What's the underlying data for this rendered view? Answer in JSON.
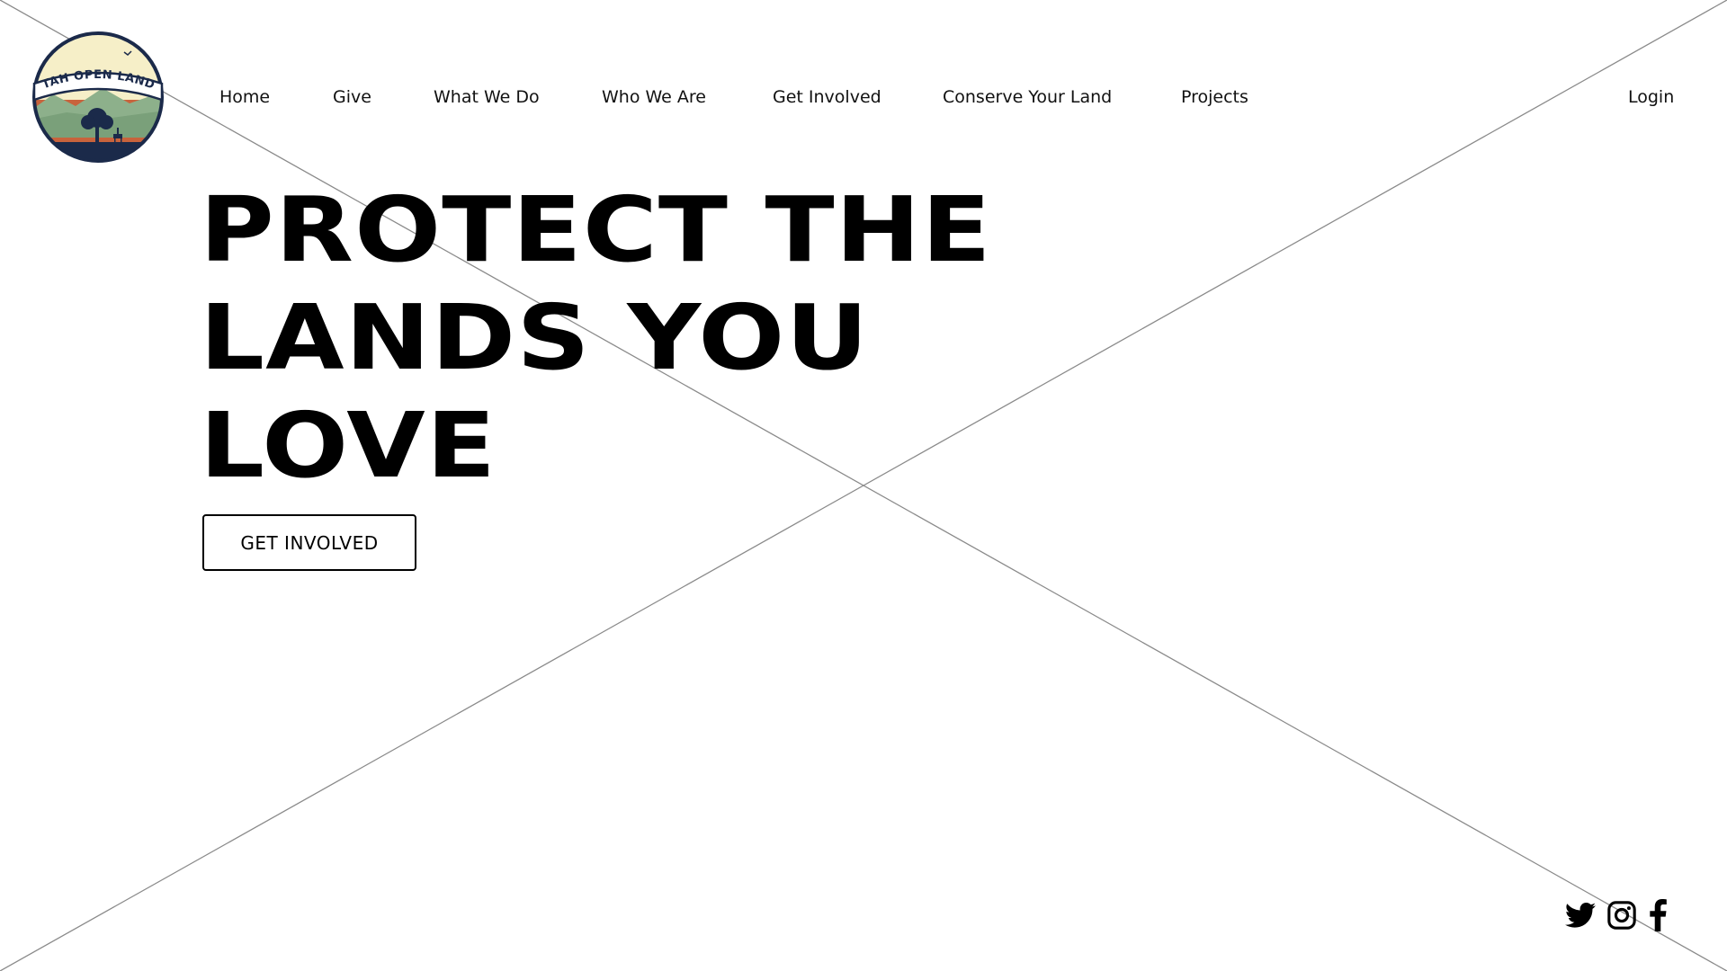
{
  "logo": {
    "text": "UTAH OPEN LANDS",
    "colors": {
      "sky": "#f6efc8",
      "mountains": "#8db08b",
      "desert": "#c8633c",
      "ground": "#1b2a4a",
      "ring": "#1b2a4a"
    }
  },
  "nav": {
    "items": [
      {
        "label": "Home"
      },
      {
        "label": "Give"
      },
      {
        "label": "What We Do"
      },
      {
        "label": "Who We Are"
      },
      {
        "label": "Get Involved"
      },
      {
        "label": "Conserve Your Land"
      },
      {
        "label": "Projects"
      }
    ],
    "login_label": "Login"
  },
  "hero": {
    "headline_lines": [
      "PROTECT THE",
      "LANDS YOU",
      "LOVE"
    ],
    "cta_label": "GET INVOLVED",
    "background": "image placeholder (crossed-out box)"
  },
  "social": {
    "icons": [
      "twitter-icon",
      "instagram-icon",
      "facebook-icon"
    ]
  }
}
